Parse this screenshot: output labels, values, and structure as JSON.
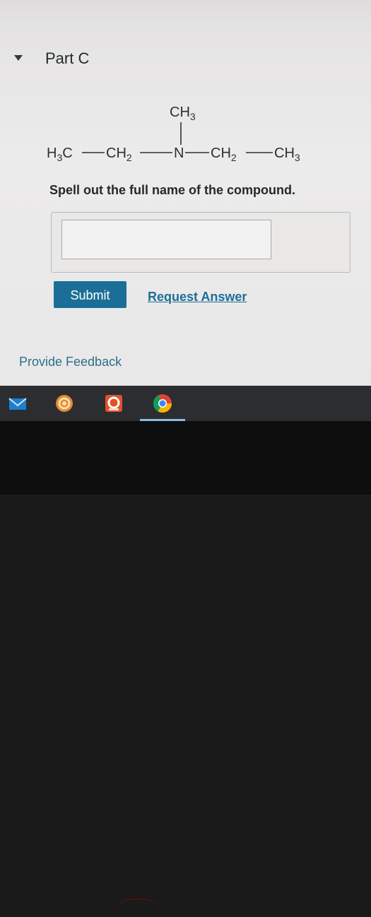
{
  "part": {
    "title": "Part C"
  },
  "structure": {
    "top_group": "CH",
    "top_group_sub": "3",
    "chain": [
      {
        "text": "H",
        "sub": "3",
        "tail": "C"
      },
      {
        "text": "CH",
        "sub": "2",
        "tail": ""
      },
      {
        "text": "N",
        "sub": "",
        "tail": ""
      },
      {
        "text": "CH",
        "sub": "2",
        "tail": ""
      },
      {
        "text": "CH",
        "sub": "3",
        "tail": ""
      }
    ]
  },
  "question": {
    "prompt": "Spell out the full name of the compound."
  },
  "answer": {
    "value": "",
    "placeholder": ""
  },
  "actions": {
    "submit_label": "Submit",
    "request_answer_label": "Request Answer"
  },
  "feedback": {
    "label": "Provide Feedback"
  },
  "taskbar": {
    "icons": [
      "mail-icon",
      "settings-app-icon",
      "office-app-icon",
      "chrome-icon"
    ]
  },
  "colors": {
    "accent": "#1b6f97",
    "link": "#1d6e98"
  }
}
